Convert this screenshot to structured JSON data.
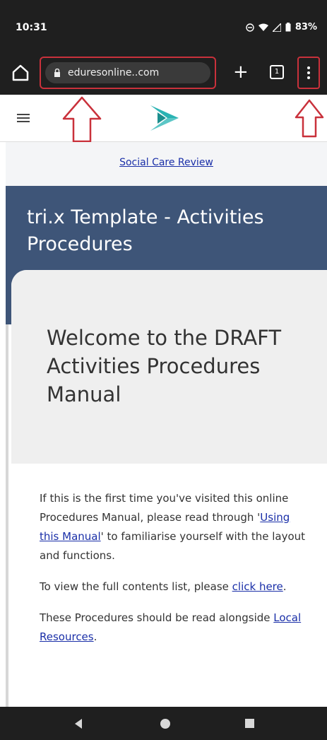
{
  "status_bar": {
    "time": "10:31",
    "icons": [
      "do-not-disturb-icon",
      "wifi-icon",
      "signal-icon",
      "battery-icon"
    ],
    "battery": "83%"
  },
  "browser": {
    "url": "eduresonline..com",
    "tab_count": "1",
    "icons": {
      "home": "home-icon",
      "lock": "lock-icon",
      "new_tab": "plus-icon",
      "tabs": "tabs-icon",
      "menu": "more-vert-icon"
    },
    "highlight_color": "#c9313b"
  },
  "site": {
    "breadcrumb": "Social Care Review",
    "page_title": "tri.x Template - Activities Procedures",
    "welcome_heading": "Welcome to the DRAFT Activities Procedures Manual",
    "paragraphs": {
      "p1_before": "If this is the first time you've visited this online Procedures Manual, please read through '",
      "p1_link": "Using this Manual",
      "p1_after": "' to familiarise yourself with the layout and functions.",
      "p2_before": "To view the full contents list, please ",
      "p2_link": "click here",
      "p2_after": ".",
      "p3_before": "These Procedures should be read alongside ",
      "p3_link": "Local Resources",
      "p3_after": "."
    },
    "colors": {
      "title_band": "#3e5578",
      "link": "#1a2fa8",
      "logo": "#2ab3b3"
    }
  },
  "nav": {
    "icons": [
      "back-icon",
      "home-circle-icon",
      "recents-icon"
    ]
  }
}
